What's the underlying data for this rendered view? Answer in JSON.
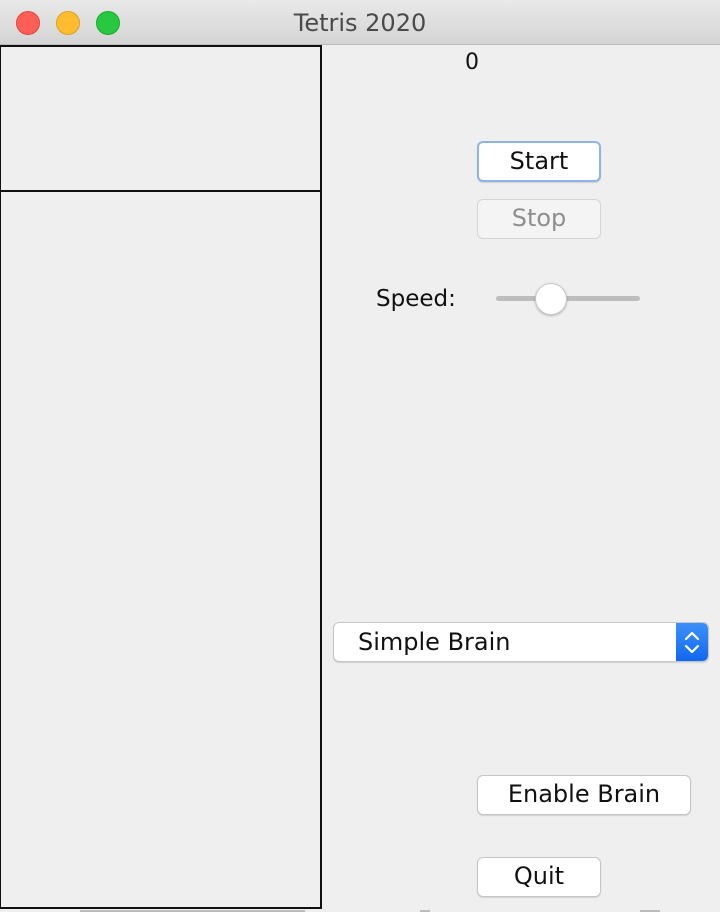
{
  "window": {
    "title": "Tetris 2020"
  },
  "score": {
    "value": "0"
  },
  "controls": {
    "start_label": "Start",
    "stop_label": "Stop",
    "speed_label": "Speed:",
    "speed_level": 0.38
  },
  "brain": {
    "selected": "Simple Brain",
    "enable_label": "Enable Brain"
  },
  "quit_label": "Quit",
  "colors": {
    "close": "#fd5f57",
    "minimize": "#febc2e",
    "maximize": "#28c840",
    "focus_ring": "#8ab4ea",
    "select_accent": "#1168f0"
  }
}
